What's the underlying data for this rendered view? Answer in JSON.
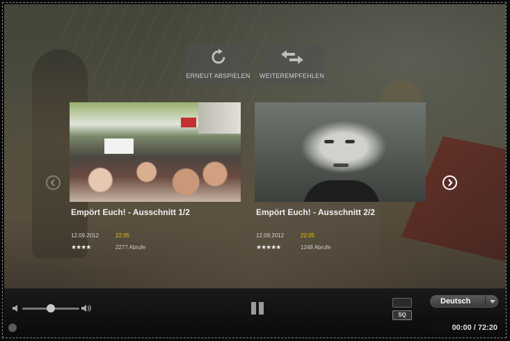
{
  "overlay": {
    "replay_label": "ERNEUT ABSPIELEN",
    "recommend_label": "WEITEREMPFEHLEN"
  },
  "related": [
    {
      "title": "Empört Euch! - Ausschnitt 1/2",
      "date": "12.09.2012",
      "time": "22:05",
      "stars": "★★★★",
      "rating": 4,
      "views": "2277 Abrufe"
    },
    {
      "title": "Empört Euch! - Ausschnitt 2/2",
      "date": "12.09.2012",
      "time": "22:05",
      "stars": "★★★★★",
      "rating": 5,
      "views": "1248 Abrufe"
    }
  ],
  "controls": {
    "volume_level": 0.5,
    "quality_label": "SQ",
    "language": "Deutsch",
    "time_display": "00:00 / 72:20"
  },
  "colors": {
    "accent_time": "#f0c800",
    "text": "#f0f0f0"
  },
  "icons": [
    "replay-icon",
    "share-arrows-icon",
    "chevron-left-icon",
    "chevron-right-icon",
    "volume-low-icon",
    "volume-high-icon",
    "pause-icon",
    "resize-icon",
    "dropdown-caret-icon"
  ]
}
